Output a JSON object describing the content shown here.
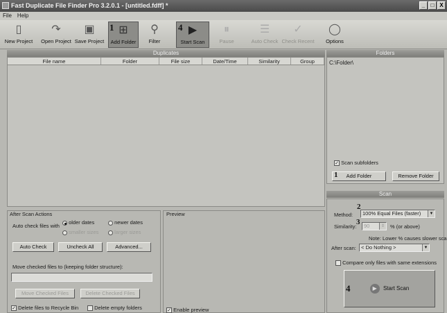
{
  "window": {
    "title": "Fast Duplicate File Finder Pro 3.2.0.1 - [untitled.fdff] *",
    "controls": [
      "_",
      "□",
      "X"
    ]
  },
  "menu": [
    "File",
    "Help"
  ],
  "toolbar": {
    "new_project": "New Project",
    "open_project": "Open Project",
    "save_project": "Save Project",
    "add_folder": "Add Folder",
    "filter": "Filter",
    "start_scan": "Start Scan",
    "pause": "Pause",
    "auto_check": "Auto Check",
    "check_recent": "Check Recent",
    "options": "Options",
    "marker_add_folder": "1",
    "marker_start_scan": "4"
  },
  "duplicates": {
    "header": "Duplicates",
    "columns": [
      "File name",
      "Folder",
      "File size",
      "Date/Time",
      "Similarity",
      "Group"
    ]
  },
  "folders": {
    "header": "Folders",
    "items": [
      "C:\\Folder\\"
    ],
    "scan_subfolders": "Scan subfolders",
    "add_folder": "Add Folder",
    "remove_folder": "Remove Folder",
    "marker": "1"
  },
  "after_scan": {
    "title": "After Scan Actions",
    "auto_check_label": "Auto check files with",
    "older_dates": "older dates",
    "newer_dates": "newer dates",
    "smaller_sizes": "smaller sizes",
    "larger_sizes": "larger sizes",
    "auto_check_btn": "Auto Check",
    "uncheck_all_btn": "Uncheck All",
    "advanced_btn": "Advanced...",
    "move_label": "Move checked files to (keeping folder structure):",
    "move_value": "",
    "move_checked_btn": "Move Checked Files",
    "delete_checked_btn": "Delete Checked Files",
    "recycle_bin": "Delete files to Recycle Bin",
    "delete_empty": "Delete empty folders"
  },
  "preview": {
    "title": "Preview",
    "enable_preview": "Enable preview"
  },
  "scan": {
    "header": "Scan",
    "method_label": "Method:",
    "method_value": "100% Equal Files (faster)",
    "method_marker": "2",
    "similarity_label": "Similarity:",
    "similarity_value": "90",
    "similarity_marker": "3",
    "similarity_suffix": "% (or above)",
    "note": "Note: Lower % causes slower scan",
    "after_scan_label": "After scan:",
    "after_scan_value": "< Do Nothing >",
    "compare_ext": "Compare only files with same extensions",
    "start_scan": "Start Scan",
    "start_marker": "4"
  }
}
